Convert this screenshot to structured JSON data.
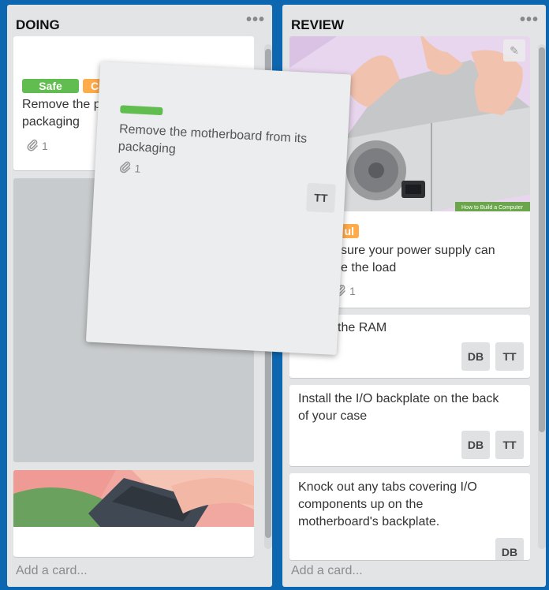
{
  "lists": {
    "doing": {
      "title": "DOING",
      "menu_icon": "ellipsis-icon",
      "add_card": "Add a card...",
      "card1": {
        "labels": [
          "Safe",
          "Car"
        ],
        "label_colors": [
          "#61bd4f",
          "#ffab4a"
        ],
        "title": "Remove the p packaging",
        "title_line1": "Remove the p",
        "title_line2": "packaging",
        "attachments": "1"
      }
    },
    "review": {
      "title": "REVIEW",
      "menu_icon": "ellipsis-icon",
      "add_card": "Add a card...",
      "card1": {
        "image_caption": "How to Build a Computer",
        "label": "ul",
        "label_color": "#ffab4a",
        "title_line1": "sure your power supply can",
        "title_line2": "e the load",
        "attachments": "1"
      },
      "card2": {
        "title": "the RAM",
        "members": [
          "DB",
          "TT"
        ]
      },
      "card3": {
        "title_line1": "Install the I/O backplate on the back",
        "title_line2": "of your case",
        "members": [
          "DB",
          "TT"
        ]
      },
      "card4": {
        "title_line1": "Knock out any tabs covering I/O",
        "title_line2": "components up on the",
        "title_line3": "motherboard's backplate.",
        "members": [
          "DB"
        ]
      }
    }
  },
  "dragged_card": {
    "label_color": "#61bd4f",
    "title_line1": "Remove the motherboard from its",
    "title_line2": "packaging",
    "attachments": "1",
    "member": "TT"
  }
}
